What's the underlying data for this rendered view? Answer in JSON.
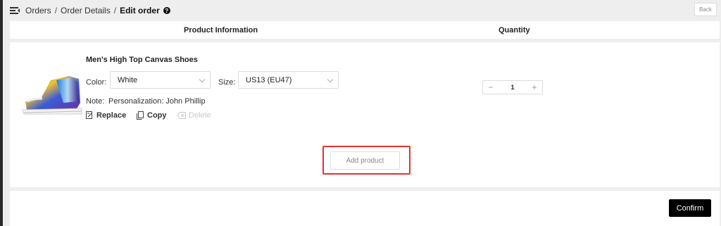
{
  "breadcrumb": {
    "items": [
      "Orders",
      "Order Details"
    ],
    "separator": "/",
    "current": "Edit order"
  },
  "header": {
    "back_label": "Back"
  },
  "table": {
    "product_header": "Product Information",
    "quantity_header": "Quantity"
  },
  "product": {
    "name": "Men's High Top Canvas Shoes",
    "color_label": "Color:",
    "color_value": "White",
    "size_label": "Size:",
    "size_value": "US13 (EU47)",
    "note_label": "Note:",
    "note_value": "Personalization: John Phillip",
    "quantity": "1"
  },
  "actions": {
    "replace": "Replace",
    "copy": "Copy",
    "delete": "Delete"
  },
  "add_product_label": "Add product",
  "confirm_label": "Confirm",
  "colors": {
    "accent": "#000000",
    "highlight": "#e0342f",
    "background": "#eeeeee"
  }
}
